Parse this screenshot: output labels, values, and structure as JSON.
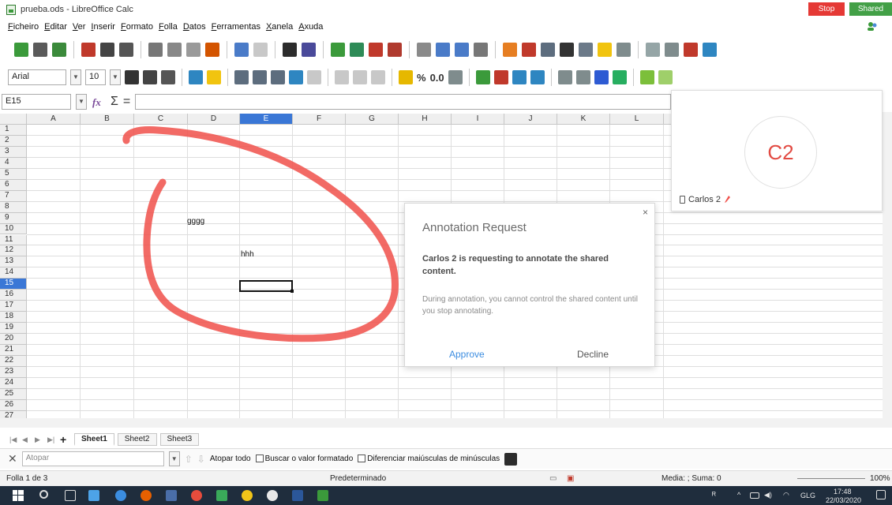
{
  "window": {
    "title": "prueba.ods - LibreOffice Calc",
    "stop_label": "Stop",
    "shared_label": "Shared"
  },
  "menu": [
    "Ficheiro",
    "Editar",
    "Ver",
    "Inserir",
    "Formato",
    "Folla",
    "Datos",
    "Ferramentas",
    "Xanela",
    "Axuda"
  ],
  "format_toolbar": {
    "font_name": "Arial",
    "font_size": "10",
    "percent_label": "%",
    "number_label": "0.0"
  },
  "formula_bar": {
    "cell_ref": "E15",
    "function_symbol": "Σ",
    "equals_symbol": "="
  },
  "grid": {
    "columns": [
      "A",
      "B",
      "C",
      "D",
      "E",
      "F",
      "G",
      "H",
      "I",
      "J",
      "K",
      "L"
    ],
    "rows": [
      "1",
      "2",
      "3",
      "4",
      "5",
      "6",
      "7",
      "8",
      "9",
      "10",
      "11",
      "12",
      "13",
      "14",
      "15",
      "16",
      "17",
      "18",
      "19",
      "20",
      "21",
      "22",
      "23",
      "24",
      "25",
      "26",
      "27"
    ],
    "active_column": "E",
    "active_row": "15",
    "cells": {
      "D9": "gggg",
      "E12": "hhh"
    }
  },
  "sheet_tabs": [
    "Sheet1",
    "Sheet2",
    "Sheet3"
  ],
  "find_bar": {
    "placeholder": "Atopar",
    "find_all": "Atopar todo",
    "formatted_value": "Buscar o valor formatado",
    "match_case": "Diferenciar maiúsculas de minúsculas"
  },
  "status": {
    "sheet_info": "Folla 1 de 3",
    "page_style": "Predeterminado",
    "sum": "Media: ; Suma: 0",
    "zoom": "100%"
  },
  "participant": {
    "initials": "C2",
    "name": "Carlos 2"
  },
  "dialog": {
    "close": "×",
    "title": "Annotation Request",
    "message": "Carlos 2 is requesting to annotate the shared content.",
    "note": "During annotation, you cannot control the shared content until you stop annotating.",
    "approve": "Approve",
    "decline": "Decline"
  },
  "taskbar": {
    "language": "GLG",
    "time": "17:48",
    "date": "22/03/2020"
  },
  "colors": {
    "annotation_stroke": "#f0504a",
    "accent_blue": "#3a77d6",
    "stop_red": "#e53935",
    "shared_green": "#43a047"
  }
}
